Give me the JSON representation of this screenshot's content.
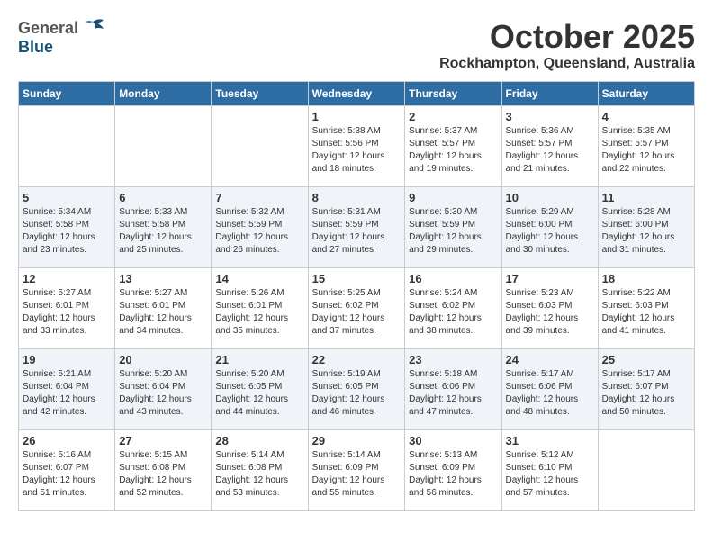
{
  "header": {
    "logo_general": "General",
    "logo_blue": "Blue",
    "month_title": "October 2025",
    "location": "Rockhampton, Queensland, Australia"
  },
  "weekdays": [
    "Sunday",
    "Monday",
    "Tuesday",
    "Wednesday",
    "Thursday",
    "Friday",
    "Saturday"
  ],
  "weeks": [
    [
      {
        "day": "",
        "info": ""
      },
      {
        "day": "",
        "info": ""
      },
      {
        "day": "",
        "info": ""
      },
      {
        "day": "1",
        "info": "Sunrise: 5:38 AM\nSunset: 5:56 PM\nDaylight: 12 hours\nand 18 minutes."
      },
      {
        "day": "2",
        "info": "Sunrise: 5:37 AM\nSunset: 5:57 PM\nDaylight: 12 hours\nand 19 minutes."
      },
      {
        "day": "3",
        "info": "Sunrise: 5:36 AM\nSunset: 5:57 PM\nDaylight: 12 hours\nand 21 minutes."
      },
      {
        "day": "4",
        "info": "Sunrise: 5:35 AM\nSunset: 5:57 PM\nDaylight: 12 hours\nand 22 minutes."
      }
    ],
    [
      {
        "day": "5",
        "info": "Sunrise: 5:34 AM\nSunset: 5:58 PM\nDaylight: 12 hours\nand 23 minutes."
      },
      {
        "day": "6",
        "info": "Sunrise: 5:33 AM\nSunset: 5:58 PM\nDaylight: 12 hours\nand 25 minutes."
      },
      {
        "day": "7",
        "info": "Sunrise: 5:32 AM\nSunset: 5:59 PM\nDaylight: 12 hours\nand 26 minutes."
      },
      {
        "day": "8",
        "info": "Sunrise: 5:31 AM\nSunset: 5:59 PM\nDaylight: 12 hours\nand 27 minutes."
      },
      {
        "day": "9",
        "info": "Sunrise: 5:30 AM\nSunset: 5:59 PM\nDaylight: 12 hours\nand 29 minutes."
      },
      {
        "day": "10",
        "info": "Sunrise: 5:29 AM\nSunset: 6:00 PM\nDaylight: 12 hours\nand 30 minutes."
      },
      {
        "day": "11",
        "info": "Sunrise: 5:28 AM\nSunset: 6:00 PM\nDaylight: 12 hours\nand 31 minutes."
      }
    ],
    [
      {
        "day": "12",
        "info": "Sunrise: 5:27 AM\nSunset: 6:01 PM\nDaylight: 12 hours\nand 33 minutes."
      },
      {
        "day": "13",
        "info": "Sunrise: 5:27 AM\nSunset: 6:01 PM\nDaylight: 12 hours\nand 34 minutes."
      },
      {
        "day": "14",
        "info": "Sunrise: 5:26 AM\nSunset: 6:01 PM\nDaylight: 12 hours\nand 35 minutes."
      },
      {
        "day": "15",
        "info": "Sunrise: 5:25 AM\nSunset: 6:02 PM\nDaylight: 12 hours\nand 37 minutes."
      },
      {
        "day": "16",
        "info": "Sunrise: 5:24 AM\nSunset: 6:02 PM\nDaylight: 12 hours\nand 38 minutes."
      },
      {
        "day": "17",
        "info": "Sunrise: 5:23 AM\nSunset: 6:03 PM\nDaylight: 12 hours\nand 39 minutes."
      },
      {
        "day": "18",
        "info": "Sunrise: 5:22 AM\nSunset: 6:03 PM\nDaylight: 12 hours\nand 41 minutes."
      }
    ],
    [
      {
        "day": "19",
        "info": "Sunrise: 5:21 AM\nSunset: 6:04 PM\nDaylight: 12 hours\nand 42 minutes."
      },
      {
        "day": "20",
        "info": "Sunrise: 5:20 AM\nSunset: 6:04 PM\nDaylight: 12 hours\nand 43 minutes."
      },
      {
        "day": "21",
        "info": "Sunrise: 5:20 AM\nSunset: 6:05 PM\nDaylight: 12 hours\nand 44 minutes."
      },
      {
        "day": "22",
        "info": "Sunrise: 5:19 AM\nSunset: 6:05 PM\nDaylight: 12 hours\nand 46 minutes."
      },
      {
        "day": "23",
        "info": "Sunrise: 5:18 AM\nSunset: 6:06 PM\nDaylight: 12 hours\nand 47 minutes."
      },
      {
        "day": "24",
        "info": "Sunrise: 5:17 AM\nSunset: 6:06 PM\nDaylight: 12 hours\nand 48 minutes."
      },
      {
        "day": "25",
        "info": "Sunrise: 5:17 AM\nSunset: 6:07 PM\nDaylight: 12 hours\nand 50 minutes."
      }
    ],
    [
      {
        "day": "26",
        "info": "Sunrise: 5:16 AM\nSunset: 6:07 PM\nDaylight: 12 hours\nand 51 minutes."
      },
      {
        "day": "27",
        "info": "Sunrise: 5:15 AM\nSunset: 6:08 PM\nDaylight: 12 hours\nand 52 minutes."
      },
      {
        "day": "28",
        "info": "Sunrise: 5:14 AM\nSunset: 6:08 PM\nDaylight: 12 hours\nand 53 minutes."
      },
      {
        "day": "29",
        "info": "Sunrise: 5:14 AM\nSunset: 6:09 PM\nDaylight: 12 hours\nand 55 minutes."
      },
      {
        "day": "30",
        "info": "Sunrise: 5:13 AM\nSunset: 6:09 PM\nDaylight: 12 hours\nand 56 minutes."
      },
      {
        "day": "31",
        "info": "Sunrise: 5:12 AM\nSunset: 6:10 PM\nDaylight: 12 hours\nand 57 minutes."
      },
      {
        "day": "",
        "info": ""
      }
    ]
  ]
}
